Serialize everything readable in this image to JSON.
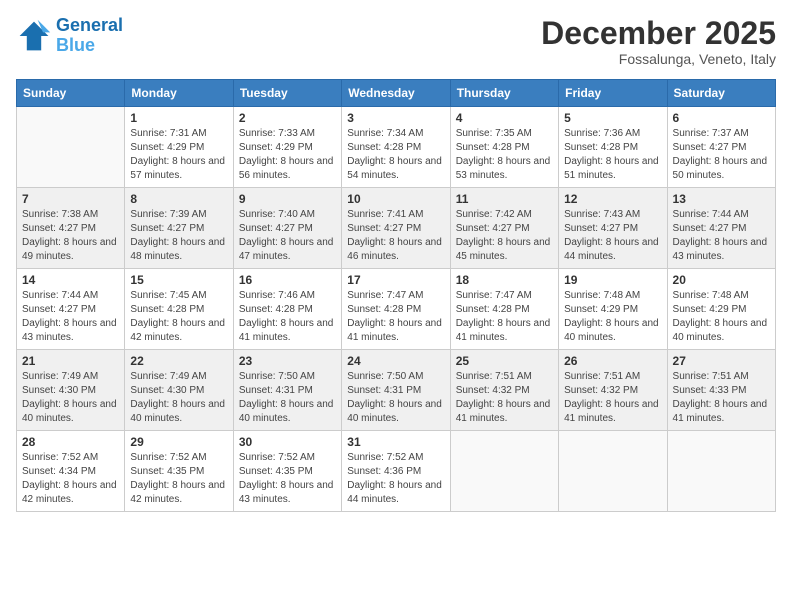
{
  "header": {
    "logo_line1": "General",
    "logo_line2": "Blue",
    "month_title": "December 2025",
    "subtitle": "Fossalunga, Veneto, Italy"
  },
  "weekdays": [
    "Sunday",
    "Monday",
    "Tuesday",
    "Wednesday",
    "Thursday",
    "Friday",
    "Saturday"
  ],
  "weeks": [
    [
      {
        "day": "",
        "sunrise": "",
        "sunset": "",
        "daylight": ""
      },
      {
        "day": "1",
        "sunrise": "Sunrise: 7:31 AM",
        "sunset": "Sunset: 4:29 PM",
        "daylight": "Daylight: 8 hours and 57 minutes."
      },
      {
        "day": "2",
        "sunrise": "Sunrise: 7:33 AM",
        "sunset": "Sunset: 4:29 PM",
        "daylight": "Daylight: 8 hours and 56 minutes."
      },
      {
        "day": "3",
        "sunrise": "Sunrise: 7:34 AM",
        "sunset": "Sunset: 4:28 PM",
        "daylight": "Daylight: 8 hours and 54 minutes."
      },
      {
        "day": "4",
        "sunrise": "Sunrise: 7:35 AM",
        "sunset": "Sunset: 4:28 PM",
        "daylight": "Daylight: 8 hours and 53 minutes."
      },
      {
        "day": "5",
        "sunrise": "Sunrise: 7:36 AM",
        "sunset": "Sunset: 4:28 PM",
        "daylight": "Daylight: 8 hours and 51 minutes."
      },
      {
        "day": "6",
        "sunrise": "Sunrise: 7:37 AM",
        "sunset": "Sunset: 4:27 PM",
        "daylight": "Daylight: 8 hours and 50 minutes."
      }
    ],
    [
      {
        "day": "7",
        "sunrise": "Sunrise: 7:38 AM",
        "sunset": "Sunset: 4:27 PM",
        "daylight": "Daylight: 8 hours and 49 minutes."
      },
      {
        "day": "8",
        "sunrise": "Sunrise: 7:39 AM",
        "sunset": "Sunset: 4:27 PM",
        "daylight": "Daylight: 8 hours and 48 minutes."
      },
      {
        "day": "9",
        "sunrise": "Sunrise: 7:40 AM",
        "sunset": "Sunset: 4:27 PM",
        "daylight": "Daylight: 8 hours and 47 minutes."
      },
      {
        "day": "10",
        "sunrise": "Sunrise: 7:41 AM",
        "sunset": "Sunset: 4:27 PM",
        "daylight": "Daylight: 8 hours and 46 minutes."
      },
      {
        "day": "11",
        "sunrise": "Sunrise: 7:42 AM",
        "sunset": "Sunset: 4:27 PM",
        "daylight": "Daylight: 8 hours and 45 minutes."
      },
      {
        "day": "12",
        "sunrise": "Sunrise: 7:43 AM",
        "sunset": "Sunset: 4:27 PM",
        "daylight": "Daylight: 8 hours and 44 minutes."
      },
      {
        "day": "13",
        "sunrise": "Sunrise: 7:44 AM",
        "sunset": "Sunset: 4:27 PM",
        "daylight": "Daylight: 8 hours and 43 minutes."
      }
    ],
    [
      {
        "day": "14",
        "sunrise": "Sunrise: 7:44 AM",
        "sunset": "Sunset: 4:27 PM",
        "daylight": "Daylight: 8 hours and 43 minutes."
      },
      {
        "day": "15",
        "sunrise": "Sunrise: 7:45 AM",
        "sunset": "Sunset: 4:28 PM",
        "daylight": "Daylight: 8 hours and 42 minutes."
      },
      {
        "day": "16",
        "sunrise": "Sunrise: 7:46 AM",
        "sunset": "Sunset: 4:28 PM",
        "daylight": "Daylight: 8 hours and 41 minutes."
      },
      {
        "day": "17",
        "sunrise": "Sunrise: 7:47 AM",
        "sunset": "Sunset: 4:28 PM",
        "daylight": "Daylight: 8 hours and 41 minutes."
      },
      {
        "day": "18",
        "sunrise": "Sunrise: 7:47 AM",
        "sunset": "Sunset: 4:28 PM",
        "daylight": "Daylight: 8 hours and 41 minutes."
      },
      {
        "day": "19",
        "sunrise": "Sunrise: 7:48 AM",
        "sunset": "Sunset: 4:29 PM",
        "daylight": "Daylight: 8 hours and 40 minutes."
      },
      {
        "day": "20",
        "sunrise": "Sunrise: 7:48 AM",
        "sunset": "Sunset: 4:29 PM",
        "daylight": "Daylight: 8 hours and 40 minutes."
      }
    ],
    [
      {
        "day": "21",
        "sunrise": "Sunrise: 7:49 AM",
        "sunset": "Sunset: 4:30 PM",
        "daylight": "Daylight: 8 hours and 40 minutes."
      },
      {
        "day": "22",
        "sunrise": "Sunrise: 7:49 AM",
        "sunset": "Sunset: 4:30 PM",
        "daylight": "Daylight: 8 hours and 40 minutes."
      },
      {
        "day": "23",
        "sunrise": "Sunrise: 7:50 AM",
        "sunset": "Sunset: 4:31 PM",
        "daylight": "Daylight: 8 hours and 40 minutes."
      },
      {
        "day": "24",
        "sunrise": "Sunrise: 7:50 AM",
        "sunset": "Sunset: 4:31 PM",
        "daylight": "Daylight: 8 hours and 40 minutes."
      },
      {
        "day": "25",
        "sunrise": "Sunrise: 7:51 AM",
        "sunset": "Sunset: 4:32 PM",
        "daylight": "Daylight: 8 hours and 41 minutes."
      },
      {
        "day": "26",
        "sunrise": "Sunrise: 7:51 AM",
        "sunset": "Sunset: 4:32 PM",
        "daylight": "Daylight: 8 hours and 41 minutes."
      },
      {
        "day": "27",
        "sunrise": "Sunrise: 7:51 AM",
        "sunset": "Sunset: 4:33 PM",
        "daylight": "Daylight: 8 hours and 41 minutes."
      }
    ],
    [
      {
        "day": "28",
        "sunrise": "Sunrise: 7:52 AM",
        "sunset": "Sunset: 4:34 PM",
        "daylight": "Daylight: 8 hours and 42 minutes."
      },
      {
        "day": "29",
        "sunrise": "Sunrise: 7:52 AM",
        "sunset": "Sunset: 4:35 PM",
        "daylight": "Daylight: 8 hours and 42 minutes."
      },
      {
        "day": "30",
        "sunrise": "Sunrise: 7:52 AM",
        "sunset": "Sunset: 4:35 PM",
        "daylight": "Daylight: 8 hours and 43 minutes."
      },
      {
        "day": "31",
        "sunrise": "Sunrise: 7:52 AM",
        "sunset": "Sunset: 4:36 PM",
        "daylight": "Daylight: 8 hours and 44 minutes."
      },
      {
        "day": "",
        "sunrise": "",
        "sunset": "",
        "daylight": ""
      },
      {
        "day": "",
        "sunrise": "",
        "sunset": "",
        "daylight": ""
      },
      {
        "day": "",
        "sunrise": "",
        "sunset": "",
        "daylight": ""
      }
    ]
  ]
}
